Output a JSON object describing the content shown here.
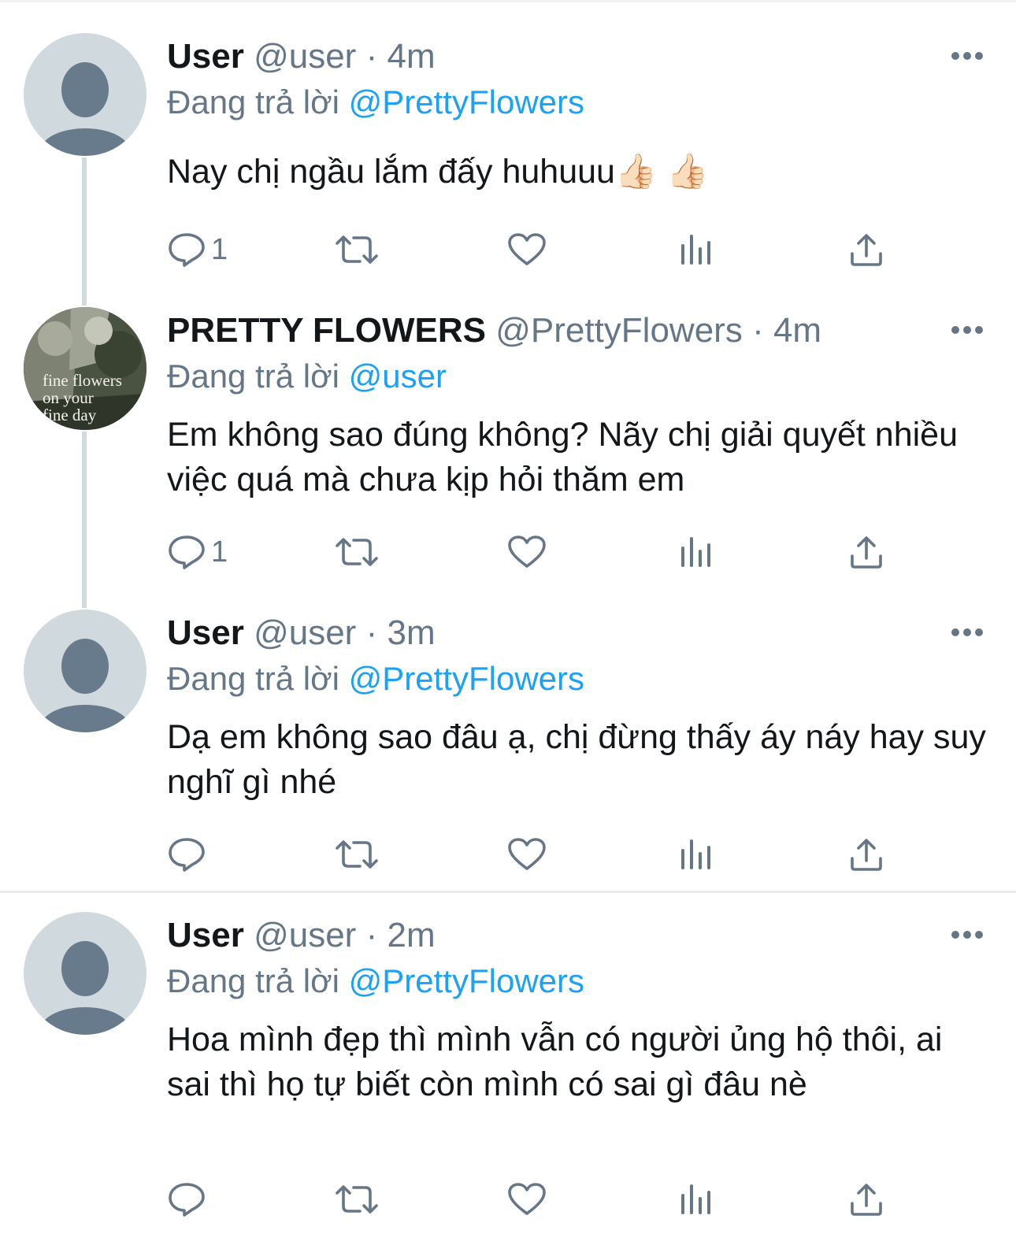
{
  "tweets": [
    {
      "author": {
        "name": "User",
        "handle": "@user",
        "avatar": "default-avatar"
      },
      "time": "4m",
      "replying_prefix": "Đang trả lời",
      "replying_to": "@PrettyFlowers",
      "text": "Nay chị ngầu lắm đấy huhuuu👍🏻 👍🏻",
      "actions": {
        "reply_count": "1",
        "retweet_count": "",
        "like_count": ""
      }
    },
    {
      "author": {
        "name": "PRETTY FLOWERS",
        "handle": "@PrettyFlowers",
        "avatar": "photo-avatar",
        "avatar_caption": [
          "fine flowers",
          "on your",
          "fine day"
        ]
      },
      "time": "4m",
      "replying_prefix": "Đang trả lời",
      "replying_to": "@user",
      "text": "Em không sao đúng không? Nãy chị giải quyết nhiều việc quá mà chưa kịp hỏi thăm em",
      "actions": {
        "reply_count": "1",
        "retweet_count": "",
        "like_count": ""
      }
    },
    {
      "author": {
        "name": "User",
        "handle": "@user",
        "avatar": "default-avatar"
      },
      "time": "3m",
      "replying_prefix": "Đang trả lời",
      "replying_to": "@PrettyFlowers",
      "text": "Dạ em không sao đâu ạ, chị đừng thấy áy náy hay suy nghĩ gì nhé",
      "actions": {
        "reply_count": "",
        "retweet_count": "",
        "like_count": ""
      }
    },
    {
      "author": {
        "name": "User",
        "handle": "@user",
        "avatar": "default-avatar"
      },
      "time": "2m",
      "replying_prefix": "Đang trả lời",
      "replying_to": "@PrettyFlowers",
      "text": "Hoa mình đẹp thì mình vẫn có người ủng hộ thôi, ai sai thì họ tự biết còn mình có sai gì đâu nè",
      "actions": {
        "reply_count": "",
        "retweet_count": "",
        "like_count": ""
      }
    }
  ],
  "separator": "·",
  "colors": {
    "text": "#14171a",
    "secondary": "#657786",
    "link": "#1da1f2",
    "thread_line": "#cfd9de",
    "avatar_bg": "#cfd9de",
    "avatar_figure": "#687b8c"
  },
  "icons": {
    "reply": "reply-icon",
    "retweet": "retweet-icon",
    "like": "heart-icon",
    "analytics": "analytics-icon",
    "share": "share-icon",
    "more": "more-icon"
  }
}
